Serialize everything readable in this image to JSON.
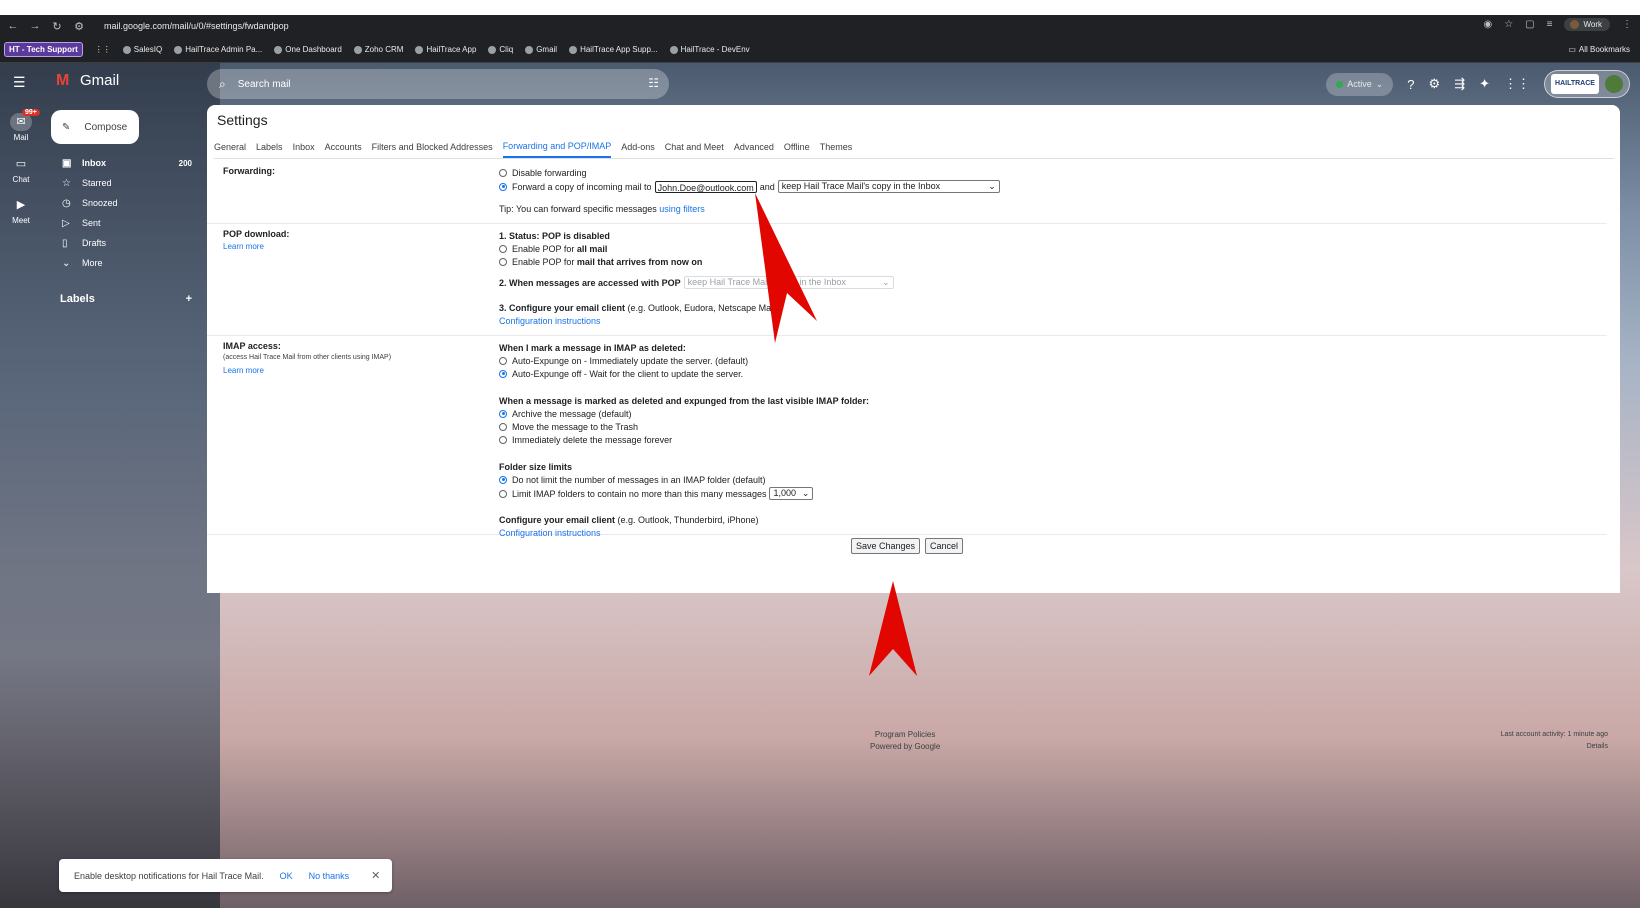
{
  "browser": {
    "url": "mail.google.com/mail/u/0/#settings/fwdandpop",
    "profile": "Work"
  },
  "bookmarks": {
    "chip": "HT - Tech Support",
    "items": [
      "SalesIQ",
      "HailTrace Admin Pa...",
      "One Dashboard",
      "Zoho CRM",
      "HailTrace App",
      "Cliq",
      "Gmail",
      "HailTrace App Supp...",
      "HailTrace - DevEnv"
    ],
    "all": "All Bookmarks"
  },
  "gmail": {
    "brand": "Gmail",
    "search_placeholder": "Search mail",
    "status": "Active",
    "account_logo": "HAILTRACE"
  },
  "rail": {
    "mail": "Mail",
    "badge": "99+",
    "chat": "Chat",
    "meet": "Meet"
  },
  "sidebar": {
    "compose": "Compose",
    "items": [
      {
        "label": "Inbox",
        "count": "200"
      },
      {
        "label": "Starred"
      },
      {
        "label": "Snoozed"
      },
      {
        "label": "Sent"
      },
      {
        "label": "Drafts"
      },
      {
        "label": "More"
      }
    ],
    "labels": "Labels",
    "labels_add": "+"
  },
  "settings": {
    "title": "Settings",
    "tabs": [
      "General",
      "Labels",
      "Inbox",
      "Accounts",
      "Filters and Blocked Addresses",
      "Forwarding and POP/IMAP",
      "Add-ons",
      "Chat and Meet",
      "Advanced",
      "Offline",
      "Themes"
    ],
    "forwarding": {
      "label": "Forwarding:",
      "disable": "Disable forwarding",
      "forward_prefix": "Forward a copy of incoming mail to",
      "email": "John.Doe@outlook.com",
      "and": "and",
      "action": "keep Hail Trace Mail's copy in the Inbox",
      "tip": "Tip: You can forward specific messages",
      "tip_link": "using filters"
    },
    "pop": {
      "label": "POP download:",
      "learn_more": "Learn more",
      "status": "1. Status: POP is disabled",
      "enable_all_prefix": "Enable POP for",
      "enable_all_bold": "all mail",
      "enable_now_prefix": "Enable POP for",
      "enable_now_bold": "mail that arrives from now on",
      "accessed": "2. When messages are accessed with POP",
      "accessed_select": "keep Hail Trace Mail's copy in the Inbox",
      "configure_bold": "3. Configure your email client",
      "configure_rest": "(e.g. Outlook, Eudora, Netscape Mail)",
      "config_link": "Configuration instructions"
    },
    "imap": {
      "label": "IMAP access:",
      "sub": "(access Hail Trace Mail from other clients using IMAP)",
      "learn_more": "Learn more",
      "deleted_head": "When I mark a message in IMAP as deleted:",
      "expunge_on": "Auto-Expunge on - Immediately update the server. (default)",
      "expunge_off": "Auto-Expunge off - Wait for the client to update the server.",
      "expunged_head": "When a message is marked as deleted and expunged from the last visible IMAP folder:",
      "archive": "Archive the message (default)",
      "trash": "Move the message to the Trash",
      "delete": "Immediately delete the message forever",
      "folder_head": "Folder size limits",
      "no_limit": "Do not limit the number of messages in an IMAP folder (default)",
      "limit": "Limit IMAP folders to contain no more than this many messages",
      "limit_value": "1,000",
      "client_bold": "Configure your email client",
      "client_rest": "(e.g. Outlook, Thunderbird, iPhone)",
      "config_link": "Configuration instructions"
    },
    "save": "Save Changes",
    "cancel": "Cancel"
  },
  "footer": {
    "policies": "Program Policies",
    "powered": "Powered by Google",
    "activity": "Last account activity: 1 minute ago",
    "details": "Details"
  },
  "toast": {
    "message": "Enable desktop notifications for Hail Trace Mail.",
    "ok": "OK",
    "no_thanks": "No thanks"
  }
}
